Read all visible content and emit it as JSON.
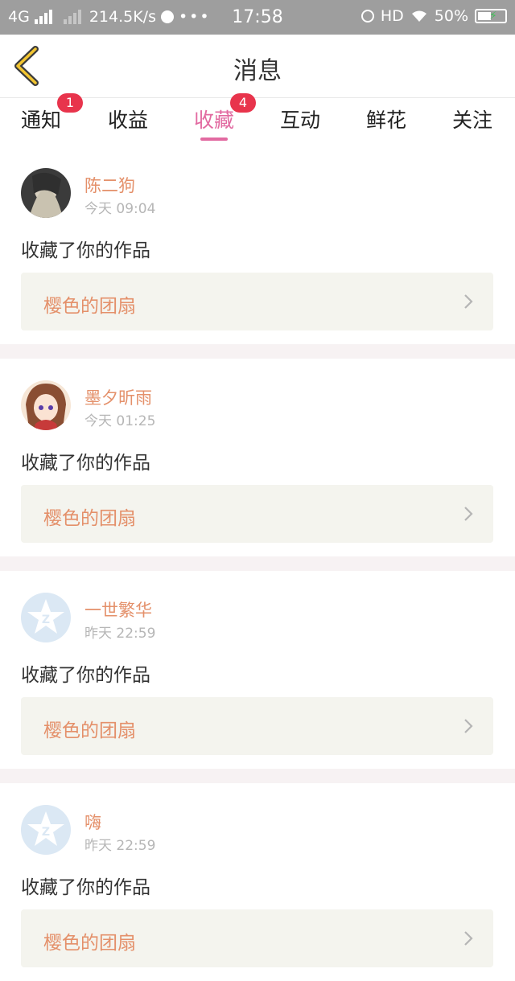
{
  "status_bar": {
    "network": "4G",
    "speed": "214.5K/s",
    "more": "•••",
    "time": "17:58",
    "hd": "HD",
    "battery": "50%"
  },
  "nav": {
    "title": "消息"
  },
  "tabs": [
    {
      "label": "通知",
      "badge": "1"
    },
    {
      "label": "收益"
    },
    {
      "label": "收藏",
      "badge": "4",
      "active": true
    },
    {
      "label": "互动"
    },
    {
      "label": "鲜花"
    },
    {
      "label": "关注"
    }
  ],
  "messages": [
    {
      "name": "陈二狗",
      "time": "今天 09:04",
      "action": "收藏了你的作品",
      "work": "樱色的团扇",
      "avatar": "dark-anime-avatar"
    },
    {
      "name": "墨夕昕雨",
      "time": "今天 01:25",
      "action": "收藏了你的作品",
      "work": "樱色的团扇",
      "avatar": "anime-girl-avatar"
    },
    {
      "name": "一世繁华",
      "time": "昨天 22:59",
      "action": "收藏了你的作品",
      "work": "樱色的团扇",
      "avatar": "default-star-avatar"
    },
    {
      "name": "嗨",
      "time": "昨天 22:59",
      "action": "收藏了你的作品",
      "work": "樱色的团扇",
      "avatar": "default-star-avatar"
    }
  ],
  "colors": {
    "accent": "#e26aa1",
    "name": "#e4906a",
    "badge": "#e8344c",
    "work_bg": "#f4f4ee"
  }
}
